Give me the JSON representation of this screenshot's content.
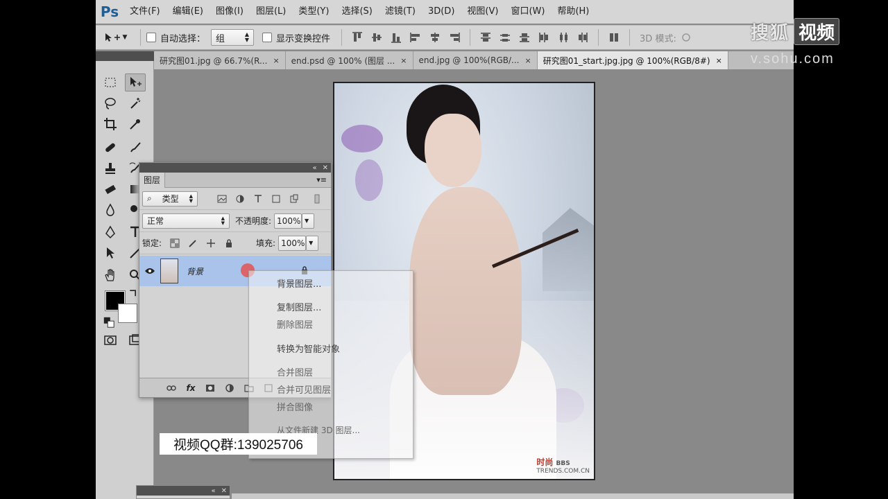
{
  "app": {
    "logo": "Ps",
    "menus": [
      "文件(F)",
      "编辑(E)",
      "图像(I)",
      "图层(L)",
      "类型(Y)",
      "选择(S)",
      "滤镜(T)",
      "3D(D)",
      "视图(V)",
      "窗口(W)",
      "帮助(H)"
    ]
  },
  "options": {
    "auto_select_label": "自动选择：",
    "auto_select_value": "组",
    "show_transform_label": "显示变换控件",
    "mode3d_label": "3D 模式:"
  },
  "tabs": [
    {
      "label": "研究图01.jpg @ 66.7%(R...",
      "close": "×"
    },
    {
      "label": "end.psd @ 100% (图层 ...",
      "close": "×"
    },
    {
      "label": "end.jpg @ 100%(RGB/...",
      "close": "×"
    },
    {
      "label": "研究图01_start.jpg.jpg @ 100%(RGB/8#)",
      "close": "×"
    }
  ],
  "layers_panel": {
    "tab": "图层",
    "filter": "类型",
    "blend_mode": "正常",
    "opacity_label": "不透明度:",
    "opacity_value": "100%",
    "lock_label": "锁定:",
    "fill_label": "填充:",
    "fill_value": "100%",
    "layer_name": "背景"
  },
  "context_menu": {
    "items": [
      "背景图层...",
      "复制图层...",
      "删除图层",
      "转换为智能对象",
      "合并图层",
      "合并可见图层",
      "拼合图像",
      "从文件新建 3D 图层..."
    ]
  },
  "canvas": {
    "watermark": "时尚",
    "watermark_sub": "BBS",
    "watermark_url": "TRENDS.COM.CN"
  },
  "overlays": {
    "qq_group": "视频QQ群:139025706",
    "sohu_cn": "搜狐",
    "sohu_video": "视频",
    "sohu_url": "v.sohu.com"
  },
  "colors": {
    "foreground": "#000000",
    "background": "#ffffff",
    "selected_layer": "#a9c3ea"
  }
}
